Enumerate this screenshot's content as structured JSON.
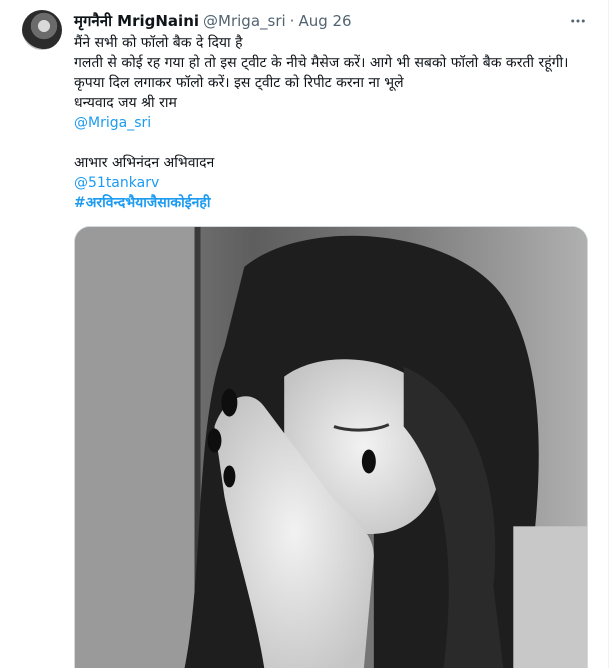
{
  "tweet": {
    "author": {
      "display_name": "मृगनैनी MrigNaini",
      "handle": "@Mriga_sri"
    },
    "separator": "·",
    "date": "Aug 26",
    "more_icon": "more-horizontal-icon",
    "lines": [
      "मैंने सभी को फॉलो बैक दे दिया है",
      "गलती से कोई रह गया हो तो इस ट्वीट के नीचे मैसेज करें। आगे भी सबको फॉलो बैक करती रहूंगी।",
      "कृपया दिल लगाकर फॉलो करें। इस ट्वीट को रिपीट करना ना भूले",
      "धन्यवाद जय श्री राम"
    ],
    "mention1": "@Mriga_sri",
    "line_after_blank": "आभार अभिनंदन अभिवादन",
    "mention2": "@51tankarv",
    "hashtag": "#अरविन्दभैयाजैसाकोईनही"
  },
  "colors": {
    "link": "#1d9bf0",
    "text": "#0f1419",
    "muted": "#536471"
  }
}
